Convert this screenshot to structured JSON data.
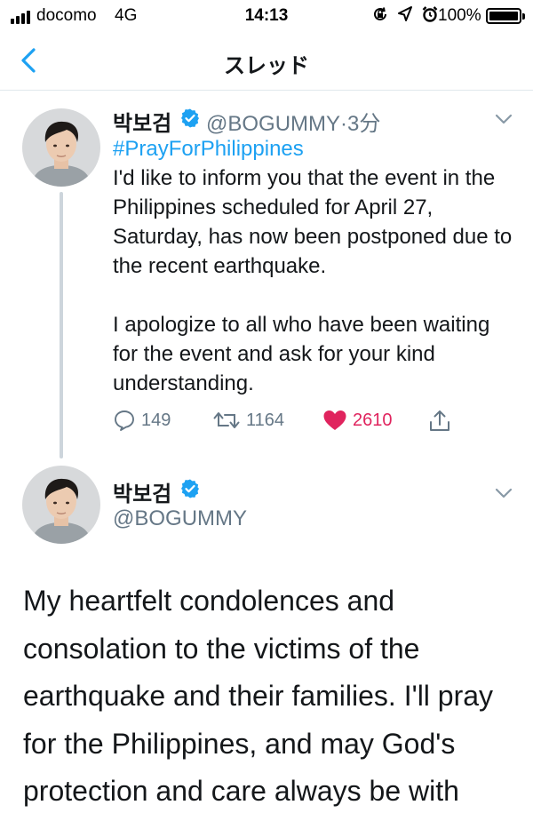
{
  "status_bar": {
    "carrier": "docomo",
    "network": "4G",
    "time": "14:13",
    "battery": "100%",
    "icons": [
      "screen-lock-icon",
      "location-icon",
      "alarm-icon"
    ]
  },
  "nav": {
    "title": "スレッド",
    "back_icon": "chevron-left-icon"
  },
  "tweet1": {
    "name": "박보검",
    "handle": "@BOGUMMY",
    "time": "3分",
    "hashtag": "#PrayForPhilippines",
    "paragraph1": "I'd like to inform you that the event in the Philippines scheduled for April 27, Saturday, has now been postponed due to the recent earthquake.",
    "paragraph2": "I apologize to all who have been waiting for the event and ask for your kind understanding.",
    "replies": "149",
    "retweets": "1164",
    "likes": "2610"
  },
  "tweet2": {
    "name": "박보검",
    "handle": "@BOGUMMY",
    "text": "My heartfelt condolences and consolation to the victims of the earthquake and their families. I'll pray for the Philippines, and may God's protection and care always be with"
  },
  "colors": {
    "accent": "#1da1f2",
    "like": "#e0245e",
    "muted": "#657786",
    "divider": "#e1e8ed"
  }
}
